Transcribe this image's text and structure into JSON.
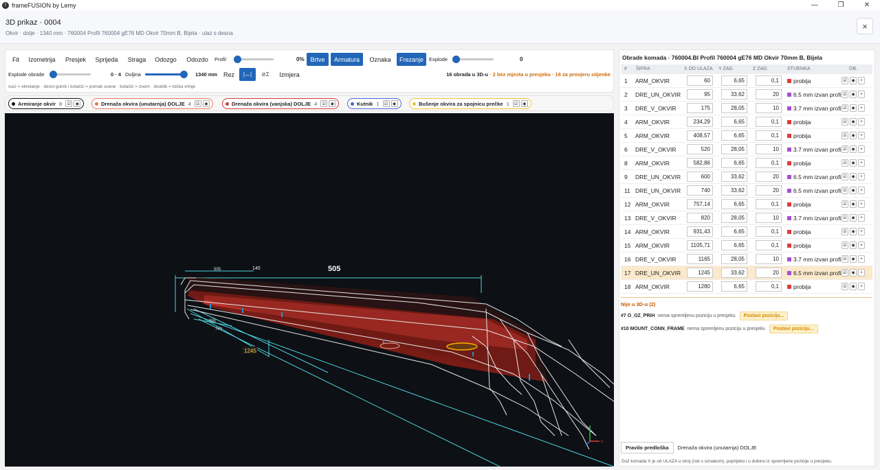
{
  "window": {
    "title": "frameFUSION by Lemy"
  },
  "header": {
    "title": "3D prikaz · 0004",
    "subtitle": "Okvir · dolje · 1340 mm · 760004 Profil 760004 gE76 MD Okvir 70mm B, Bijela · ulaz s desna",
    "close_label": "×"
  },
  "toolbar": {
    "views": [
      "Fit",
      "Izometrija",
      "Presjek",
      "Sprijeda",
      "Straga",
      "Odozgo",
      "Odozdo"
    ],
    "profil_label": "Profil",
    "profil_value": "0%",
    "profil_fraction": 0,
    "brtve_label": "Brtve",
    "armatura_label": "Armatura",
    "oznaka_label": "Oznaka",
    "frezanje_label": "Frezanje",
    "explode_label": "Explode",
    "explode_value": "0",
    "explode_fraction": 0,
    "explode_obrade_label": "Explode obrade",
    "explode_obrade_value": "0 · 4",
    "explode_obrade_fraction": 0,
    "duljina_label": "Duljina",
    "duljina_value": "1340 mm",
    "duljina_fraction": 1,
    "rez_label": "Rez",
    "rez_icon": "|↔|",
    "sym_label": "⊘Σ",
    "izmjera_label": "Izmjera",
    "status_main": "16 obrada u 3D-u",
    "status_warn": " · 2 bez mjesta u presjeku · 16 za provjeru stijenke",
    "hint": "vuci = okretanje · desni gumb i kotačić = pomak scene · kotačić = zoom · dvoklik = točka vrtnje",
    "accent": "#2266b8"
  },
  "chips": [
    {
      "label": "Armiranje okvir",
      "count": "8",
      "color": "#111111"
    },
    {
      "label": "Drenaža okvira (unutarnja) DOLJE",
      "count": "4",
      "color": "#e8765a"
    },
    {
      "label": "Drenaža okvira (vanjska) DOLJE",
      "count": "4",
      "color": "#d63b3b"
    },
    {
      "label": "Kutnik",
      "count": "1",
      "color": "#4b63d6"
    },
    {
      "label": "Bušenje okvira za spojnicu prečke",
      "count": "1",
      "color": "#f0c23a"
    }
  ],
  "viewport": {
    "dims": [
      "505",
      "140",
      "505",
      "1245",
      "690",
      "740"
    ],
    "axis_label": "x"
  },
  "panel": {
    "title": "Obrade komada · 760004.BI Profil 760004 gE76 MD Okvir 70mm B, Bijela",
    "columns": [
      "#",
      "ŠIFRA",
      "X OD ULAZA",
      "Y ZAD.",
      "Z ZAD.",
      "STIJENKA",
      "OB."
    ],
    "rows": [
      {
        "n": "1",
        "code": "ARM_OKVIR",
        "x": "60",
        "y": "6,65",
        "z": "0,1",
        "wall": "probija",
        "color": "#e03b3b"
      },
      {
        "n": "2",
        "code": "DRE_UN_OKVIR",
        "x": "95",
        "y": "33,62",
        "z": "20",
        "wall": "6.5 mm izvan profila",
        "color": "#a64fd6"
      },
      {
        "n": "3",
        "code": "DRE_V_OKVIR",
        "x": "175",
        "y": "28,05",
        "z": "10",
        "wall": "3.7 mm izvan profila",
        "color": "#a64fd6"
      },
      {
        "n": "4",
        "code": "ARM_OKVIR",
        "x": "234,29",
        "y": "6,65",
        "z": "0,1",
        "wall": "probija",
        "color": "#e03b3b"
      },
      {
        "n": "5",
        "code": "ARM_OKVIR",
        "x": "408,57",
        "y": "6,65",
        "z": "0,1",
        "wall": "probija",
        "color": "#e03b3b"
      },
      {
        "n": "6",
        "code": "DRE_V_OKVIR",
        "x": "520",
        "y": "28,05",
        "z": "10",
        "wall": "3.7 mm izvan profila",
        "color": "#a64fd6"
      },
      {
        "n": "8",
        "code": "ARM_OKVIR",
        "x": "582,86",
        "y": "6,65",
        "z": "0,1",
        "wall": "probija",
        "color": "#e03b3b"
      },
      {
        "n": "9",
        "code": "DRE_UN_OKVIR",
        "x": "600",
        "y": "33,62",
        "z": "20",
        "wall": "6.5 mm izvan profila",
        "color": "#a64fd6"
      },
      {
        "n": "11",
        "code": "DRE_UN_OKVIR",
        "x": "740",
        "y": "33,62",
        "z": "20",
        "wall": "6.5 mm izvan profila",
        "color": "#a64fd6"
      },
      {
        "n": "12",
        "code": "ARM_OKVIR",
        "x": "757,14",
        "y": "6,65",
        "z": "0,1",
        "wall": "probija",
        "color": "#e03b3b"
      },
      {
        "n": "13",
        "code": "DRE_V_OKVIR",
        "x": "820",
        "y": "28,05",
        "z": "10",
        "wall": "3.7 mm izvan profila",
        "color": "#a64fd6"
      },
      {
        "n": "14",
        "code": "ARM_OKVIR",
        "x": "931,43",
        "y": "6,65",
        "z": "0,1",
        "wall": "probija",
        "color": "#e03b3b"
      },
      {
        "n": "15",
        "code": "ARM_OKVIR",
        "x": "1105,71",
        "y": "6,65",
        "z": "0,1",
        "wall": "probija",
        "color": "#e03b3b"
      },
      {
        "n": "16",
        "code": "DRE_V_OKVIR",
        "x": "1165",
        "y": "28,05",
        "z": "10",
        "wall": "3.7 mm izvan profila",
        "color": "#a64fd6"
      },
      {
        "n": "17",
        "code": "DRE_UN_OKVIR",
        "x": "1245",
        "y": "33,62",
        "z": "20",
        "wall": "6.5 mm izvan profila",
        "color": "#a64fd6",
        "highlight": true
      },
      {
        "n": "18",
        "code": "ARM_OKVIR",
        "x": "1280",
        "y": "6,65",
        "z": "0,1",
        "wall": "probija",
        "color": "#e03b3b"
      }
    ],
    "row_icons": [
      "☑",
      "◉",
      "+"
    ],
    "not_in_3d_title": "Nije u 3D-u (2)",
    "not_in_3d": [
      {
        "code": "#7 O_OZ_PRIH",
        "note": "nema spremljenu poziciju u presjeku",
        "button": "Postavi poziciju..."
      },
      {
        "code": "#10 MOUNT_CONN_FRAME",
        "note": "nema spremljenu poziciju u presjeku",
        "button": "Postavi poziciju..."
      }
    ],
    "rule_button": "Pravilo predloška",
    "rule_value": "Drenaža okvira (unutarnja) DOLJE",
    "footer": "Duž komada X je od ULAZA u stroj (rub s oznakom), poprijeko i u dubinu iz spremljene pozicije u presjeku."
  }
}
